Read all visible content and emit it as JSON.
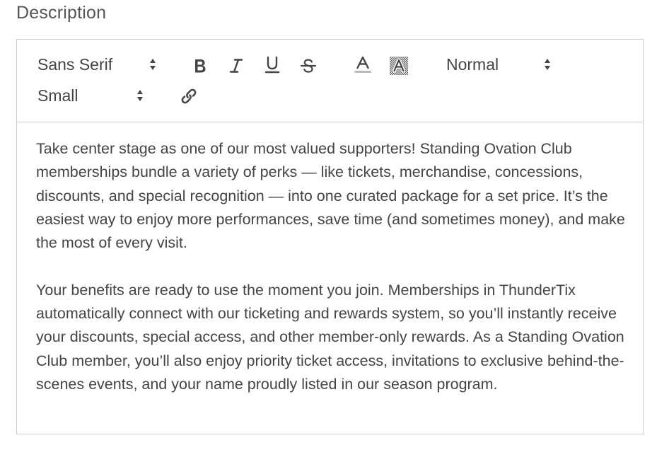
{
  "field": {
    "label": "Description"
  },
  "toolbar": {
    "font_picker": {
      "value": "Sans Serif",
      "icon": "updown-arrows-icon"
    },
    "bold": {
      "label": "B",
      "icon": "bold-icon"
    },
    "italic": {
      "label": "I",
      "icon": "italic-icon"
    },
    "underline": {
      "label": "U",
      "icon": "underline-icon"
    },
    "strike": {
      "label": "S",
      "icon": "strikethrough-icon"
    },
    "text_color": {
      "label": "A",
      "icon": "text-color-icon"
    },
    "background_color": {
      "label": "A",
      "icon": "background-color-icon"
    },
    "header_picker": {
      "value": "Normal",
      "icon": "updown-arrows-icon"
    },
    "size_picker": {
      "value": "Small",
      "icon": "updown-arrows-icon"
    },
    "link": {
      "icon": "link-icon"
    }
  },
  "content": {
    "paragraph_1": "Take center stage as one of our most valued supporters! Standing Ovation Club memberships bundle a variety of perks — like tickets, merchandise, concessions, discounts, and special recognition — into one curated package for a set price. It’s the easiest way to enjoy more performances, save time (and sometimes money), and make the most of every visit.",
    "paragraph_2": "Your benefits are ready to use the moment you join. Memberships in ThunderTix automatically connect with our ticketing and rewards system, so you’ll instantly receive your discounts, special access, and other member-only rewards. As a Standing Ovation Club member, you’ll also enjoy priority ticket access, invitations to exclusive behind-the-scenes events, and your name proudly listed in our season program."
  },
  "colors": {
    "border": "#cccccc",
    "text": "#444444",
    "label": "#555555",
    "color_underline": "#bbbbbb"
  }
}
